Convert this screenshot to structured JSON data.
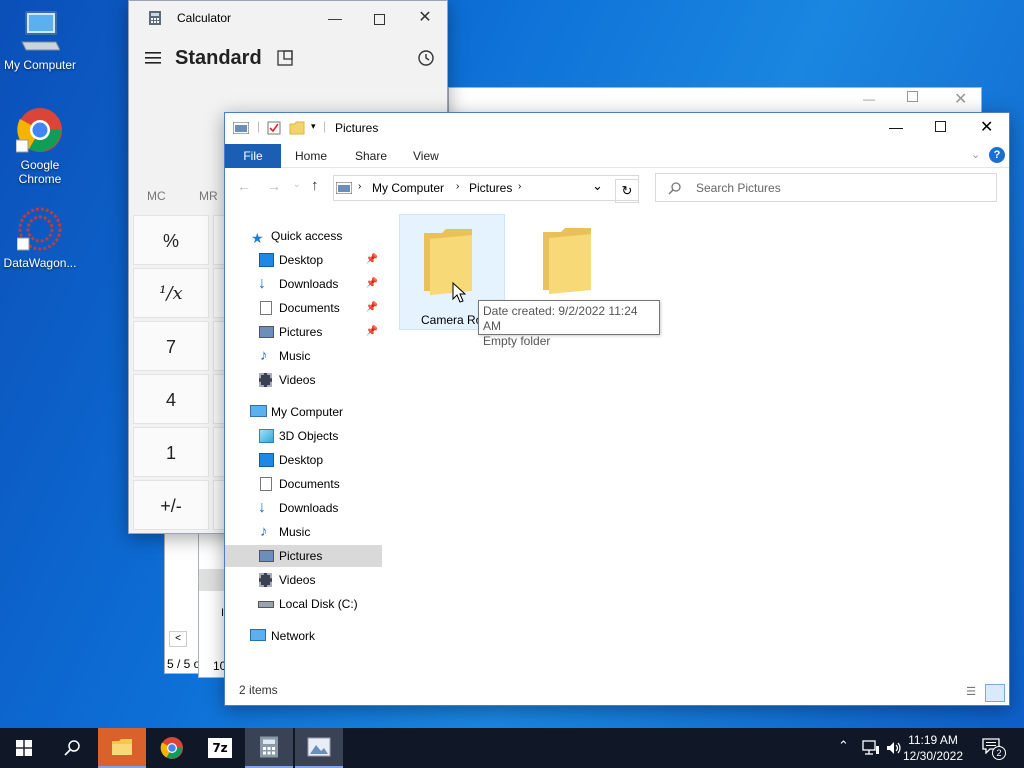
{
  "desktop": {
    "icons": [
      {
        "label": "My Computer"
      },
      {
        "label": "Google Chrome"
      },
      {
        "label": "DataWagon..."
      }
    ]
  },
  "calculator": {
    "title": "Calculator",
    "mode": "Standard",
    "memory": [
      "MC",
      "MR"
    ],
    "keys": [
      "%",
      "¹/x",
      "7",
      "4",
      "1",
      "+/-"
    ]
  },
  "explorer": {
    "title": "Pictures",
    "ribbon_tabs": [
      "File",
      "Home",
      "Share",
      "View"
    ],
    "breadcrumb": [
      "My Computer",
      "Pictures"
    ],
    "search_placeholder": "Search Pictures",
    "nav": {
      "quick_access": "Quick access",
      "quick_items": [
        "Desktop",
        "Downloads",
        "Documents",
        "Pictures",
        "Music",
        "Videos"
      ],
      "my_computer": "My Computer",
      "pc_items": [
        "3D Objects",
        "Desktop",
        "Documents",
        "Downloads",
        "Music",
        "Pictures",
        "Videos",
        "Local Disk (C:)"
      ],
      "network": "Network"
    },
    "items": [
      {
        "name": "Camera Ro"
      },
      {
        "name": ""
      }
    ],
    "tooltip": {
      "line1": "Date created: 9/2/2022 11:24 AM",
      "line2": "Empty folder"
    },
    "status": "2 items"
  },
  "background_window": {
    "text1": "5 / 5 o",
    "text2": "10",
    "text3": "I"
  },
  "taskbar": {
    "time": "11:19 AM",
    "date": "12/30/2022",
    "notification_count": "2"
  },
  "colors": {
    "accent": "#1a5fb4",
    "selection": "#cce8ff",
    "taskbar": "#101726"
  }
}
